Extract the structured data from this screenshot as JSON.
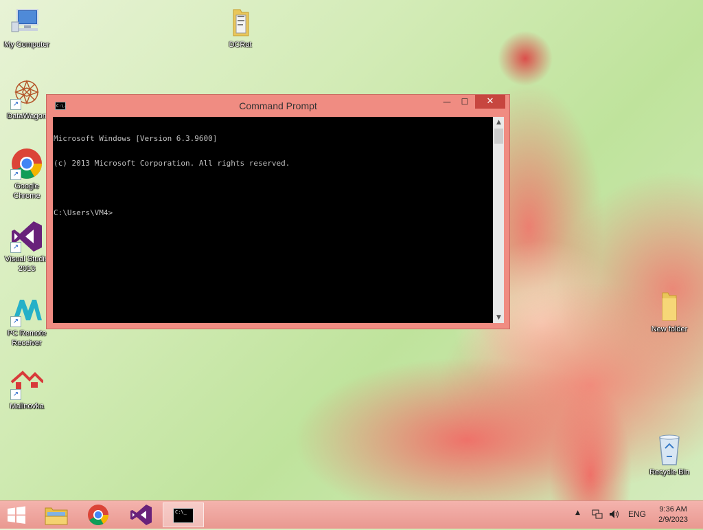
{
  "desktop": {
    "icons": [
      {
        "name": "My Computer"
      },
      {
        "name": "DCRat"
      },
      {
        "name": "DataWagon"
      },
      {
        "name": "Google Chrome"
      },
      {
        "name": "Visual Studio 2013"
      },
      {
        "name": "PC Remote Receiver"
      },
      {
        "name": "Malinovka"
      },
      {
        "name": "New folder"
      },
      {
        "name": "Recycle Bin"
      }
    ]
  },
  "window": {
    "title": "Command Prompt",
    "icon_text": "C:\\.",
    "min_symbol": "—",
    "max_symbol": "☐",
    "close_symbol": "✕",
    "console_lines": [
      "Microsoft Windows [Version 6.3.9600]",
      "(c) 2013 Microsoft Corporation. All rights reserved.",
      "",
      "C:\\Users\\VM4>"
    ]
  },
  "taskbar": {
    "language": "ENG",
    "time": "9:36 AM",
    "date": "2/9/2023",
    "buttons": [
      "start",
      "file-explorer",
      "google-chrome",
      "visual-studio",
      "command-prompt"
    ],
    "active": "command-prompt"
  },
  "colors": {
    "window_frame": "#f08c82",
    "close_button": "#c7463f",
    "console_bg": "#000000",
    "console_text": "#c0c0c0",
    "taskbar": "#eea49c"
  }
}
